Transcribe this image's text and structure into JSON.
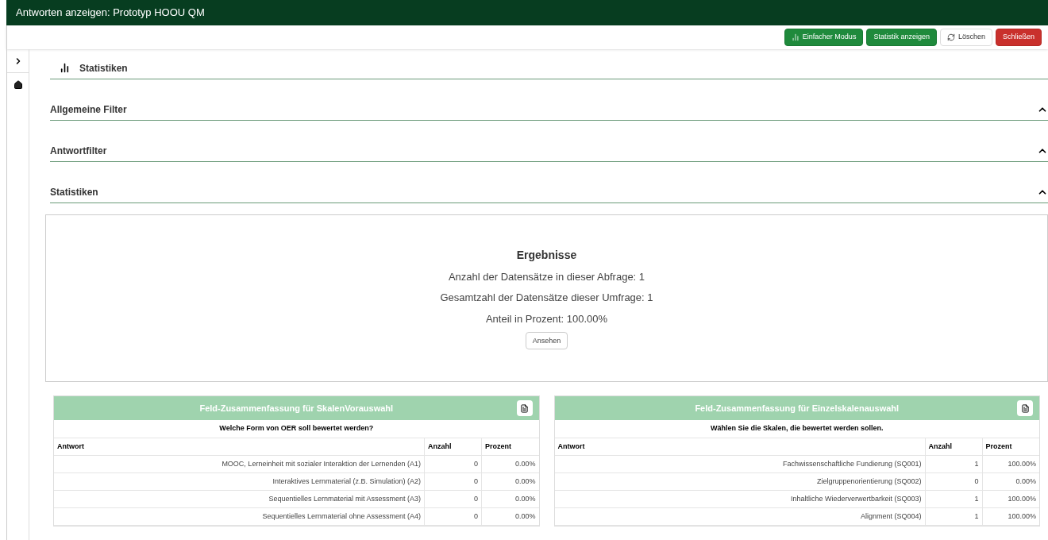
{
  "window": {
    "title": "Antworten anzeigen: Prototyp HOOU QM"
  },
  "toolbar": [
    {
      "label": "Einfacher Modus",
      "kind": "primary",
      "icon": true
    },
    {
      "label": "Statistik anzeigen",
      "kind": "primary",
      "icon": false
    },
    {
      "label": "Löschen",
      "kind": "reset",
      "icon": true
    },
    {
      "label": "Schließen",
      "kind": "danger",
      "icon": false
    }
  ],
  "page_title": "Statistiken",
  "sections": [
    {
      "title": "Allgemeine Filter",
      "expanded": true
    },
    {
      "title": "Antwortfilter",
      "expanded": true
    },
    {
      "title": "Statistiken",
      "expanded": true
    }
  ],
  "results": {
    "title": "Ergebnisse",
    "lines": [
      "Anzahl der Datensätze in dieser Abfrage: 1",
      "Gesamtzahl der Datensätze dieser Umfrage: 1",
      "Anteil in Prozent: 100.00%"
    ],
    "button": "Ansehen"
  },
  "tables": [
    {
      "title": "Feld-Zusammenfassung für SkalenVorauswahl",
      "question": "Welche Form von OER soll bewertet werden?",
      "columns": [
        "Antwort",
        "Anzahl",
        "Prozent"
      ],
      "rows": [
        [
          "MOOC, Lerneinheit mit sozialer Interaktion der Lernenden (A1)",
          "0",
          "0.00%"
        ],
        [
          "Interaktives Lernmaterial (z.B. Simulation) (A2)",
          "0",
          "0.00%"
        ],
        [
          "Sequentielles Lernmaterial mit Assessment (A3)",
          "0",
          "0.00%"
        ],
        [
          "Sequentielles Lernmaterial ohne Assessment (A4)",
          "0",
          "0.00%"
        ]
      ]
    },
    {
      "title": "Feld-Zusammenfassung für Einzelskalenauswahl",
      "question": "Wählen Sie die Skalen, die bewertet werden sollen.",
      "columns": [
        "Antwort",
        "Anzahl",
        "Prozent"
      ],
      "rows": [
        [
          "Fachwissenschaftliche Fundierung (SQ001)",
          "1",
          "100.00%"
        ],
        [
          "Zielgruppenorientierung (SQ002)",
          "0",
          "0.00%"
        ],
        [
          "Inhaltliche Wiederverwertbarkeit (SQ003)",
          "1",
          "100.00%"
        ],
        [
          "Alignment (SQ004)",
          "1",
          "100.00%"
        ]
      ]
    }
  ]
}
